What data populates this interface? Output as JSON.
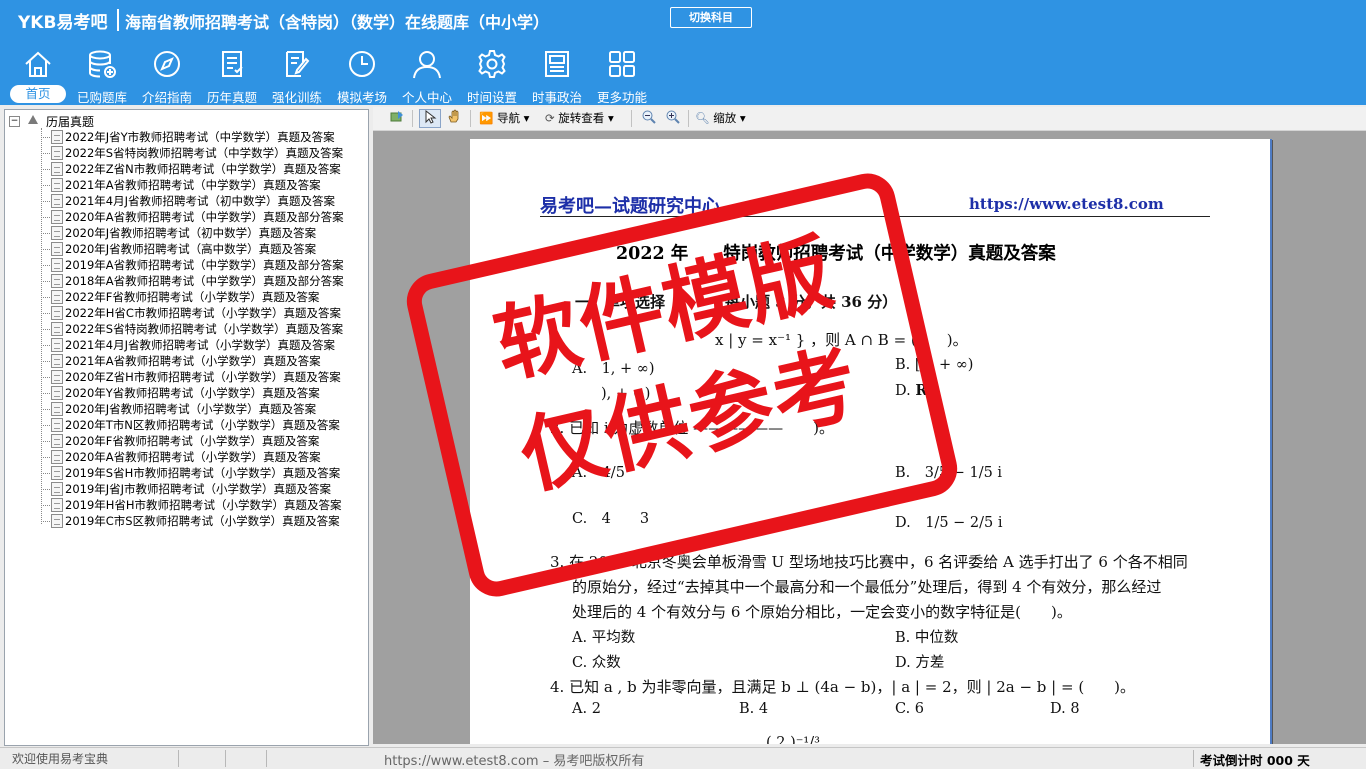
{
  "header": {
    "logo": "YKB易考吧",
    "title": "海南省教师招聘考试（含特岗）（数学）在线题库（中小学）",
    "switch_button": "切换科目"
  },
  "nav": [
    {
      "label": "首页",
      "icon": "home-icon",
      "active": true
    },
    {
      "label": "已购题库",
      "icon": "database-icon"
    },
    {
      "label": "介绍指南",
      "icon": "compass-icon"
    },
    {
      "label": "历年真题",
      "icon": "document-list-icon"
    },
    {
      "label": "强化训练",
      "icon": "edit-icon"
    },
    {
      "label": "模拟考场",
      "icon": "clock-icon"
    },
    {
      "label": "个人中心",
      "icon": "user-icon"
    },
    {
      "label": "时间设置",
      "icon": "gear-icon"
    },
    {
      "label": "时事政治",
      "icon": "news-icon"
    },
    {
      "label": "更多功能",
      "icon": "grid-icon"
    }
  ],
  "tree": {
    "root": "历届真题",
    "expander": "−",
    "items": [
      "2022年J省Y市教师招聘考试（中学数学）真题及答案",
      "2022年S省特岗教师招聘考试（中学数学）真题及答案",
      "2022年Z省N市教师招聘考试（中学数学）真题及答案",
      "2021年A省教师招聘考试（中学数学）真题及答案",
      "2021年4月J省教师招聘考试（初中数学）真题及答案",
      "2020年A省教师招聘考试（中学数学）真题及部分答案",
      "2020年J省教师招聘考试（初中数学）真题及答案",
      "2020年J省教师招聘考试（高中数学）真题及答案",
      "2019年A省教师招聘考试（中学数学）真题及部分答案",
      "2018年A省教师招聘考试（中学数学）真题及部分答案",
      "2022年F省教师招聘考试（小学数学）真题及答案",
      "2022年H省C市教师招聘考试（小学数学）真题及答案",
      "2022年S省特岗教师招聘考试（小学数学）真题及答案",
      "2021年4月J省教师招聘考试（小学数学）真题及答案",
      "2021年A省教师招聘考试（小学数学）真题及答案",
      "2020年Z省H市教师招聘考试（小学数学）真题及答案",
      "2020年Y省教师招聘考试（小学数学）真题及答案",
      "2020年J省教师招聘考试（小学数学）真题及答案",
      "2020年T市N区教师招聘考试（小学数学）真题及答案",
      "2020年F省教师招聘考试（小学数学）真题及答案",
      "2020年A省教师招聘考试（小学数学）真题及答案",
      "2019年S省H市教师招聘考试（小学数学）真题及答案",
      "2019年J省J市教师招聘考试（小学数学）真题及答案",
      "2019年H省H市教师招聘考试（小学数学）真题及答案",
      "2019年C市S区教师招聘考试（小学数学）真题及答案"
    ]
  },
  "toolbar": {
    "navigate": "导航",
    "rotate": "旋转查看",
    "zoom": "缩放",
    "dropdown_glyph": "▾"
  },
  "document": {
    "header_left": "易考吧—试题研究中心",
    "header_right": "https://www.etest8.com",
    "title": "2022 年　　特岗教师招聘考试（中学数学）真题及答案",
    "section": "一、单项选择　　　　每小题 3 分，共 36 分）",
    "q1_stem": "　　　　　　　　　　　x | y = x⁻¹ } ，则 A ∩ B = (　　)。",
    "q1_optA": "A.　1, + ∞)",
    "q1_optB": "B. [1, + ∞)",
    "q1_optC": "　　), + ∞)",
    "q1_optD": "D.",
    "q1_optD_value": "R",
    "q2_stem": "2. 已知 i 为虚数单位 ——————　　)。",
    "q2_optB": "B.　3/5 − 1/5 i",
    "q2_optD": "D.　1/5 − 2/5 i",
    "q2_optA_frag": "A.　4/5",
    "q2_optC_frag": "C.　4　　3",
    "q3_line1": "3. 在 2022 北京冬奥会单板滑雪 U 型场地技巧比赛中，6 名评委给 A 选手打出了 6 个各不相同",
    "q3_line2": "的原始分，经过“去掉其中一个最高分和一个最低分”处理后，得到 4 个有效分，那么经过",
    "q3_line3": "处理后的 4 个有效分与 6 个原始分相比，一定会变小的数字特征是(　　)。",
    "q3_optA": "A. 平均数",
    "q3_optB": "B. 中位数",
    "q3_optC": "C. 众数",
    "q3_optD": "D. 方差",
    "q4_stem": "4. 已知 a , b 为非零向量，且满足 b ⊥ (4a − b)，| a | = 2，则 | 2a − b | = (　　)。",
    "q4_optA": "A. 2",
    "q4_optB": "B. 4",
    "q4_optC": "C. 6",
    "q4_optD": "D. 8",
    "q5_fragment": "( 2 )⁻¹/³"
  },
  "stamp": {
    "line1": "软件模版",
    "line2": "仅供参考",
    "color": "#e8141a"
  },
  "status": {
    "welcome": "欢迎使用易考宝典",
    "center": "https://www.etest8.com – 易考吧版权所有",
    "countdown": "考试倒计时 000 天"
  },
  "colors": {
    "header_bg": "#2f93e3",
    "doc_header": "#1d2fa8"
  }
}
